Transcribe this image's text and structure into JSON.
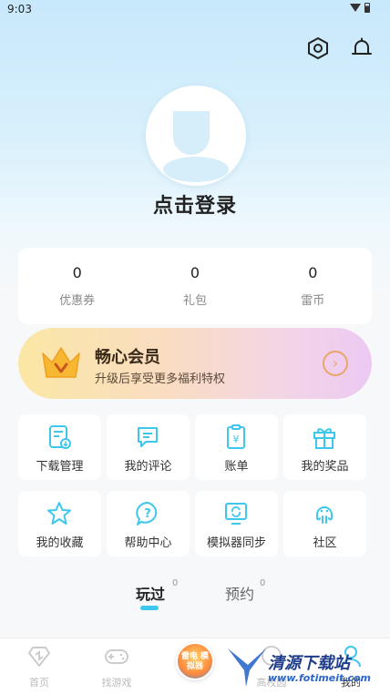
{
  "status_bar": {
    "time": "9:03"
  },
  "header": {
    "settings_icon": "hexagon-settings-icon",
    "notification_icon": "bell-icon"
  },
  "profile": {
    "login_text": "点击登录"
  },
  "stats": [
    {
      "value": "0",
      "label": "优惠券"
    },
    {
      "value": "0",
      "label": "礼包"
    },
    {
      "value": "0",
      "label": "雷币"
    }
  ],
  "vip": {
    "title": "畅心会员",
    "subtitle": "升级后享受更多福利特权",
    "arrow": "›"
  },
  "grid": [
    {
      "label": "下载管理",
      "icon": "download-manage-icon"
    },
    {
      "label": "我的评论",
      "icon": "comment-icon"
    },
    {
      "label": "账单",
      "icon": "bill-icon"
    },
    {
      "label": "我的奖品",
      "icon": "gift-icon"
    },
    {
      "label": "我的收藏",
      "icon": "star-icon"
    },
    {
      "label": "帮助中心",
      "icon": "help-icon"
    },
    {
      "label": "模拟器同步",
      "icon": "sync-icon"
    },
    {
      "label": "社区",
      "icon": "community-icon"
    }
  ],
  "tabs": [
    {
      "label": "玩过",
      "count": "0",
      "active": true
    },
    {
      "label": "预约",
      "count": "0",
      "active": false
    }
  ],
  "bottom_nav": {
    "items": [
      {
        "label": "首页"
      },
      {
        "label": "找游戏"
      },
      {
        "label": "高校园"
      },
      {
        "label": "我的"
      }
    ],
    "center_badge": "雷电 模拟器"
  },
  "watermark": {
    "text": "清源下载站",
    "url": "www.fotimeit.com"
  },
  "colors": {
    "accent": "#3ec7ec",
    "vip_gold": "#fbe7a5"
  }
}
